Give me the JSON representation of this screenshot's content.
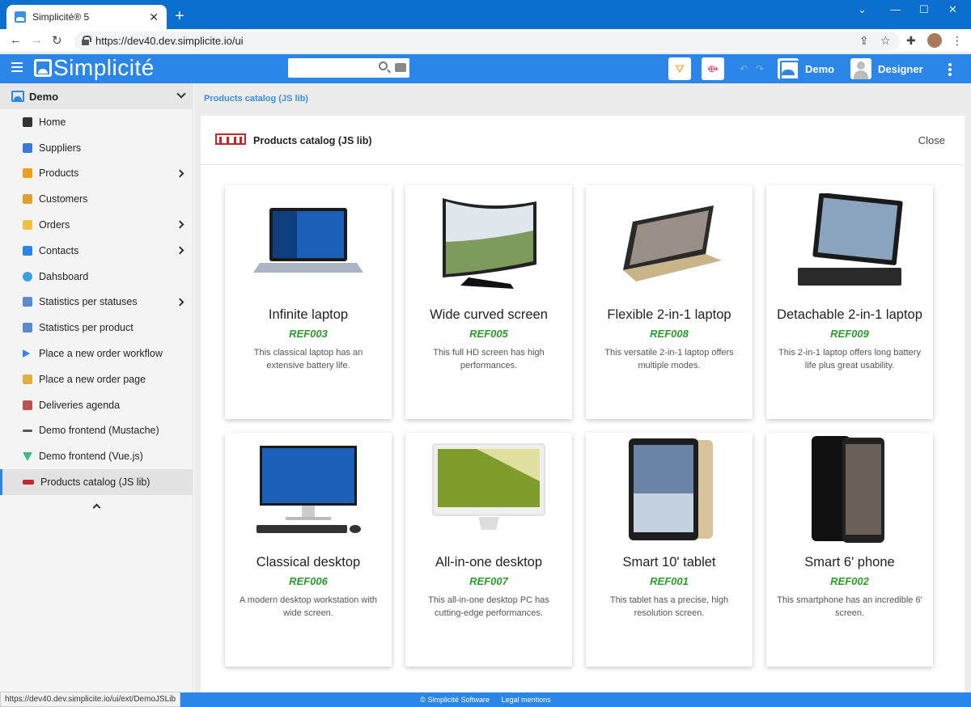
{
  "browser": {
    "tab_title": "Simplicité® 5",
    "tab_close": "✕",
    "new_tab": "+",
    "url": "https://dev40.dev.simplicite.io/ui",
    "status_url": "https://dev40.dev.simplicite.io/ui/ext/DemoJSLib"
  },
  "header": {
    "logo_text": "Simplicité",
    "user_scope": "Demo",
    "user_name": "Designer"
  },
  "sidebar": {
    "scope": "Demo",
    "items": [
      {
        "label": "Home",
        "icon": "home-icon",
        "color": "#333333",
        "has_sub": false
      },
      {
        "label": "Suppliers",
        "icon": "suppliers-icon",
        "color": "#3a7bd5",
        "has_sub": false
      },
      {
        "label": "Products",
        "icon": "products-icon",
        "color": "#f0a020",
        "has_sub": true
      },
      {
        "label": "Customers",
        "icon": "customers-icon",
        "color": "#e0a030",
        "has_sub": false
      },
      {
        "label": "Orders",
        "icon": "orders-icon",
        "color": "#f0c040",
        "has_sub": true
      },
      {
        "label": "Contacts",
        "icon": "contacts-icon",
        "color": "#2c86e8",
        "has_sub": true
      },
      {
        "label": "Dahsboard",
        "icon": "dashboard-icon",
        "color": "#3aa0e0",
        "has_sub": false
      },
      {
        "label": "Statistics per statuses",
        "icon": "stats-icon",
        "color": "#5a8ad0",
        "has_sub": true
      },
      {
        "label": "Statistics per product",
        "icon": "stats-icon",
        "color": "#5a8ad0",
        "has_sub": false
      },
      {
        "label": "Place a new order workflow",
        "icon": "play-icon",
        "color": "#2c86e8",
        "has_sub": false
      },
      {
        "label": "Place a new order page",
        "icon": "order-page-icon",
        "color": "#e0b040",
        "has_sub": false
      },
      {
        "label": "Deliveries agenda",
        "icon": "calendar-icon",
        "color": "#c05050",
        "has_sub": false
      },
      {
        "label": "Demo frontend (Mustache)",
        "icon": "mustache-icon",
        "color": "#555555",
        "has_sub": false
      },
      {
        "label": "Demo frontend (Vue.js)",
        "icon": "vue-icon",
        "color": "#42b883",
        "has_sub": false
      },
      {
        "label": "Products catalog (JS lib)",
        "icon": "npm-icon",
        "color": "#c3272b",
        "has_sub": false,
        "active": true
      }
    ]
  },
  "main": {
    "breadcrumb": "Products catalog (JS lib)",
    "panel_title": "Products catalog (JS lib)",
    "close_label": "Close"
  },
  "products": [
    {
      "name": "Infinite laptop",
      "ref": "REF003",
      "desc": "This classical laptop has an extensive battery life.",
      "kind": "laptop"
    },
    {
      "name": "Wide curved screen",
      "ref": "REF005",
      "desc": "This full HD screen has high performances.",
      "kind": "screen"
    },
    {
      "name": "Flexible 2-in-1 laptop",
      "ref": "REF008",
      "desc": "This versatile 2-in-1 laptop offers multiple modes.",
      "kind": "flex"
    },
    {
      "name": "Detachable 2-in-1 laptop",
      "ref": "REF009",
      "desc": "This 2-in-1 laptop offers long battery life plus great usability.",
      "kind": "detach"
    },
    {
      "name": "Classical desktop",
      "ref": "REF006",
      "desc": "A modern desktop workstation with wide screen.",
      "kind": "desktop"
    },
    {
      "name": "All-in-one desktop",
      "ref": "REF007",
      "desc": "This all-in-one desktop PC has cutting-edge performances.",
      "kind": "aio"
    },
    {
      "name": "Smart 10' tablet",
      "ref": "REF001",
      "desc": "This tablet has a precise, high resolution screen.",
      "kind": "tablet"
    },
    {
      "name": "Smart 6' phone",
      "ref": "REF002",
      "desc": "This smartphone has an incredible 6' screen.",
      "kind": "phone"
    }
  ],
  "footer": {
    "copyright": "© Simplicité Software",
    "legal": "Legal mentions"
  },
  "colors": {
    "brand_blue": "#2c86e8",
    "ref_green": "#2d9a2d",
    "npm_red": "#c3272b"
  }
}
